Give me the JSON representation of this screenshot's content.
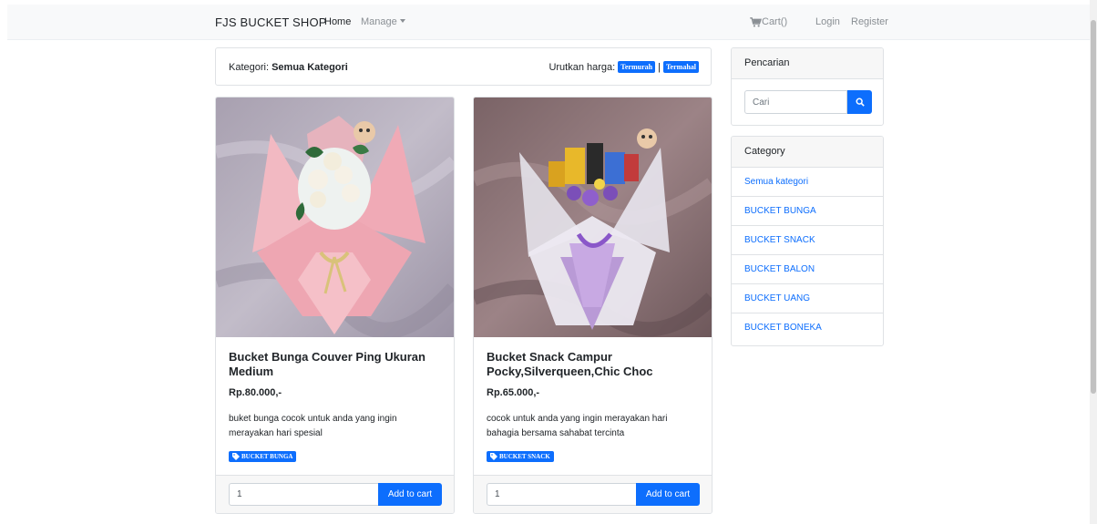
{
  "navbar": {
    "brand": "FJS BUCKET SHOP",
    "home": "Home",
    "manage": "Manage",
    "cart": "Cart()",
    "login": "Login",
    "register": "Register"
  },
  "filter": {
    "kategori_prefix": "Kategori: ",
    "kategori_value": "Semua Kategori",
    "sort_label": "Urutkan harga:",
    "sort_cheapest": "Termurah",
    "sort_expensive": "Termahal"
  },
  "products": [
    {
      "title": "Bucket Bunga Couver Ping Ukuran Medium",
      "price": "Rp.80.000,-",
      "description": "buket bunga cocok untuk anda yang ingin merayakan hari spesial",
      "category_badge": "BUCKET BUNGA",
      "quantity": "1",
      "add_label": "Add to cart"
    },
    {
      "title": "Bucket Snack Campur Pocky,Silverqueen,Chic Choc",
      "price": "Rp.65.000,-",
      "description": "cocok untuk anda yang ingin merayakan hari bahagia bersama sahabat tercinta",
      "category_badge": "BUCKET SNACK",
      "quantity": "1",
      "add_label": "Add to cart"
    }
  ],
  "sidebar": {
    "search_title": "Pencarian",
    "search_placeholder": "Cari",
    "category_title": "Category",
    "categories": [
      "Semua kategori",
      "BUCKET BUNGA",
      "BUCKET SNACK",
      "BUCKET BALON",
      "BUCKET UANG",
      "BUCKET BONEKA"
    ]
  },
  "colors": {
    "primary": "#0d6efd",
    "navbar_bg": "#f8f9fa",
    "link": "#0d6efd"
  }
}
